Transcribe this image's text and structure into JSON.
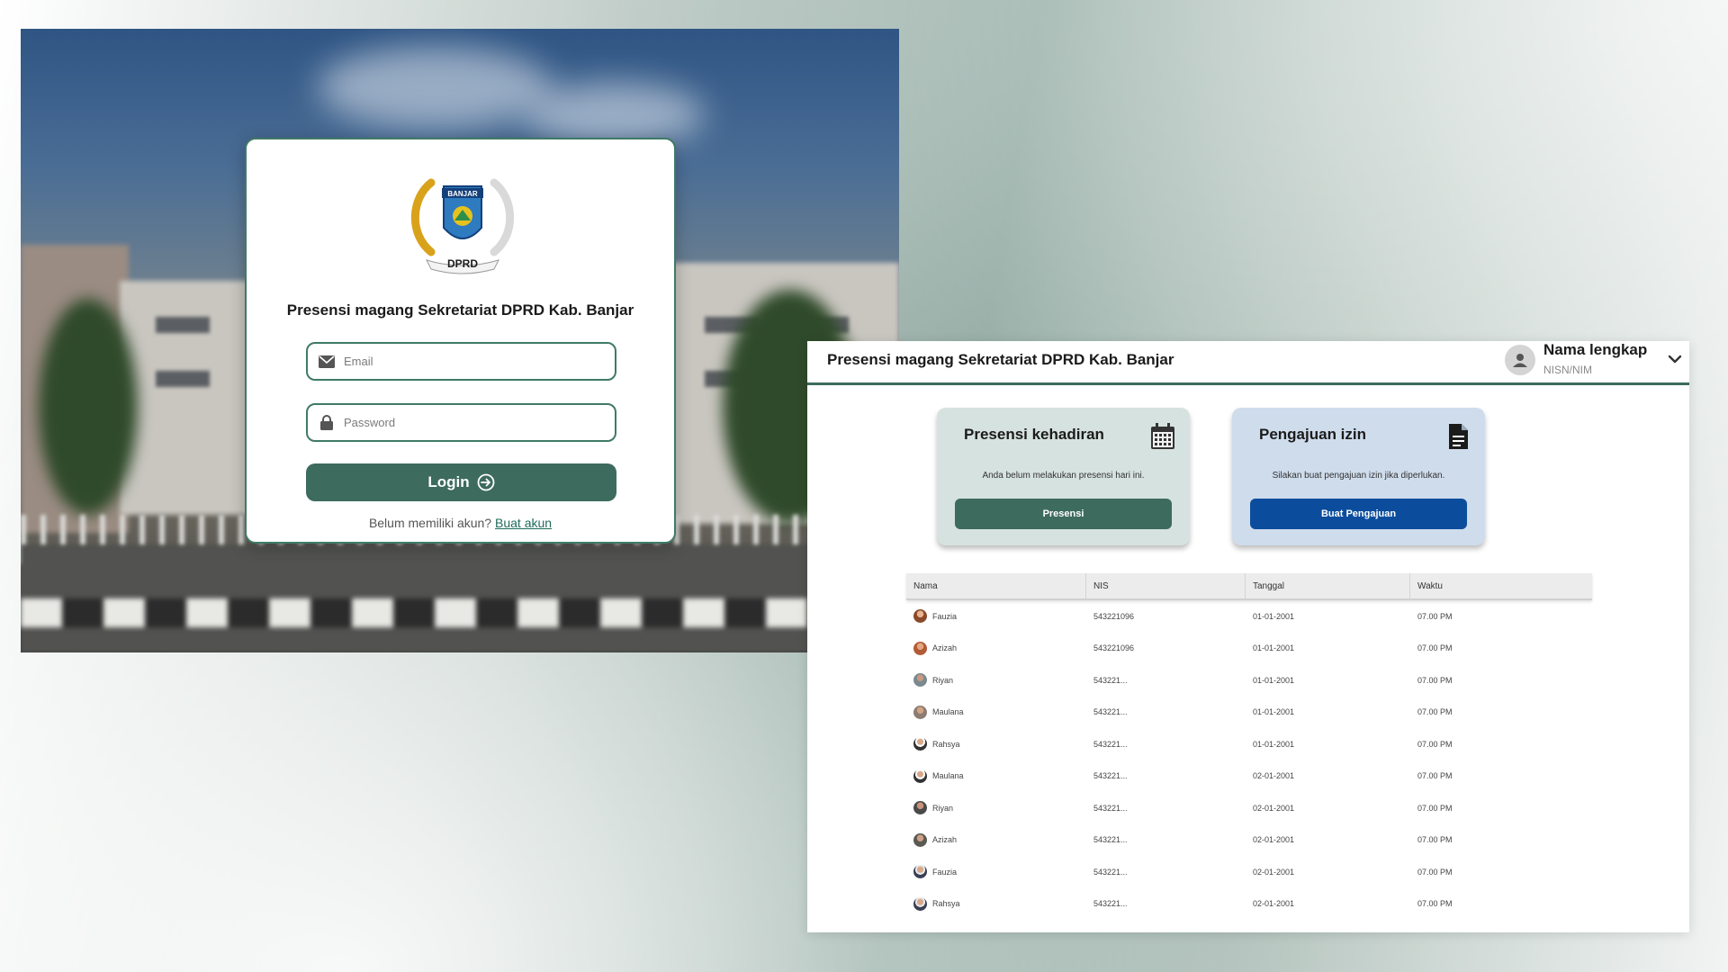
{
  "login": {
    "logo": {
      "banner_text": "BANJAR",
      "label": "DPRD"
    },
    "title": "Presensi magang Sekretariat DPRD Kab. Banjar",
    "email_placeholder": "Email",
    "password_placeholder": "Password",
    "login_label": "Login",
    "signup_prompt": "Belum memiliki akun?",
    "signup_link": "Buat akun"
  },
  "dashboard": {
    "header": {
      "title": "Presensi magang Sekretariat DPRD Kab. Banjar",
      "user_name": "Nama lengkap",
      "user_id": "NISN/NIM"
    },
    "cards": {
      "presensi": {
        "title": "Presensi kehadiran",
        "text": "Anda belum melakukan presensi hari ini.",
        "button": "Presensi"
      },
      "izin": {
        "title": "Pengajuan izin",
        "text": "Silakan buat pengajuan izin jika diperlukan.",
        "button": "Buat Pengajuan"
      }
    },
    "table": {
      "columns": [
        "Nama",
        "NIS",
        "Tanggal",
        "Waktu"
      ],
      "rows": [
        {
          "nama": "Fauzia",
          "nis": "543221096",
          "tanggal": "01-01-2001",
          "waktu": "07.00 PM"
        },
        {
          "nama": "Azizah",
          "nis": "543221096",
          "tanggal": "01-01-2001",
          "waktu": "07.00 PM"
        },
        {
          "nama": "Riyan",
          "nis": "543221...",
          "tanggal": "01-01-2001",
          "waktu": "07.00 PM"
        },
        {
          "nama": "Maulana",
          "nis": "543221...",
          "tanggal": "01-01-2001",
          "waktu": "07.00 PM"
        },
        {
          "nama": "Rahsya",
          "nis": "543221...",
          "tanggal": "01-01-2001",
          "waktu": "07.00 PM"
        },
        {
          "nama": "Maulana",
          "nis": "543221...",
          "tanggal": "02-01-2001",
          "waktu": "07.00 PM"
        },
        {
          "nama": "Riyan",
          "nis": "543221...",
          "tanggal": "02-01-2001",
          "waktu": "07.00 PM"
        },
        {
          "nama": "Azizah",
          "nis": "543221...",
          "tanggal": "02-01-2001",
          "waktu": "07.00 PM"
        },
        {
          "nama": "Fauzia",
          "nis": "543221...",
          "tanggal": "02-01-2001",
          "waktu": "07.00 PM"
        },
        {
          "nama": "Rahsya",
          "nis": "543221...",
          "tanggal": "02-01-2001",
          "waktu": "07.00 PM"
        }
      ]
    }
  },
  "colors": {
    "brand_green": "#3d6b5e",
    "brand_blue": "#0b4d9c",
    "card_green_bg": "#d6e2df",
    "card_blue_bg": "#cfdcec"
  },
  "icons": {
    "email": "envelope-icon",
    "password": "lock-icon",
    "login": "arrow-circle-icon",
    "user": "user-icon",
    "dropdown": "chevron-down-icon",
    "presensi": "calendar-icon",
    "izin": "document-icon"
  }
}
